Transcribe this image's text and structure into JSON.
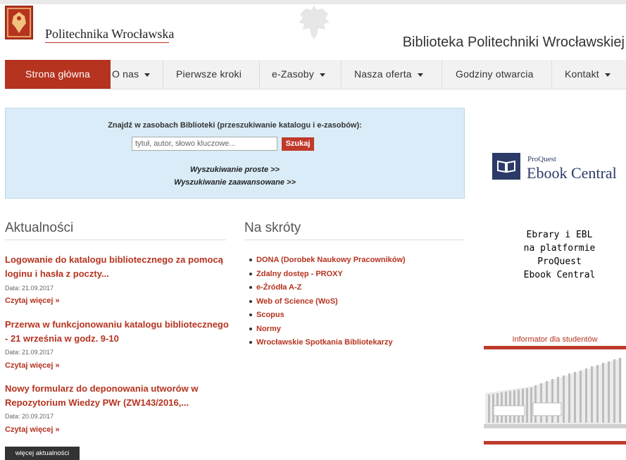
{
  "header": {
    "university": "Politechnika Wrocławska",
    "library": "Biblioteka Politechniki Wrocławskiej"
  },
  "nav": {
    "items": [
      {
        "label": "Strona główna",
        "active": true,
        "dropdown": false
      },
      {
        "label": "O nas",
        "dropdown": true
      },
      {
        "label": "Pierwsze kroki",
        "dropdown": false
      },
      {
        "label": "e-Zasoby",
        "dropdown": true
      },
      {
        "label": "Nasza oferta",
        "dropdown": true
      },
      {
        "label": "Godziny otwarcia",
        "dropdown": false
      },
      {
        "label": "Kontakt",
        "dropdown": true
      }
    ]
  },
  "search": {
    "label": "Znajdź w zasobach Biblioteki (przeszukiwanie katalogu i e-zasobów):",
    "placeholder": "tytuł, autor, słowo kluczowe...",
    "button": "Szukaj",
    "simple": "Wyszukiwanie proste >>",
    "advanced": "Wyszukiwanie zaawansowane >>"
  },
  "news": {
    "title": "Aktualności",
    "items": [
      {
        "title": "Logowanie do katalogu bibliotecznego za pomocą loginu i hasła z poczty...",
        "date": "Data: 21.09.2017",
        "more": "Czytaj więcej »"
      },
      {
        "title": "Przerwa w funkcjonowaniu katalogu bibliotecznego - 21 września w godz. 9-10",
        "date": "Data: 21.09.2017",
        "more": "Czytaj więcej »"
      },
      {
        "title": "Nowy formularz do deponowania utworów w Repozytorium Wiedzy PWr (ZW143/2016,...",
        "date": "Data: 20.09.2017",
        "more": "Czytaj więcej »"
      }
    ],
    "more_button": "więcej aktualności"
  },
  "shortcuts": {
    "title": "Na skróty",
    "items": [
      "DONA (Dorobek Naukowy Pracowników)",
      "Zdalny dostęp - PROXY",
      "e-Źródła A-Z",
      "Web of Science (WoS)",
      "Scopus",
      "Normy",
      "Wrocławskie Spotkania Bibliotekarzy"
    ]
  },
  "sidebar": {
    "proquest_small": "ProQuest",
    "proquest_big": "Ebook Central",
    "ebrary_lines": [
      "Ebrary i EBL",
      "na platformie",
      "ProQuest",
      "Ebook Central"
    ],
    "informator": "Informator dla studentów"
  },
  "colors": {
    "accent": "#b5331f",
    "search_bg": "#d9ecf7",
    "nav_bg": "#f2f2f2"
  }
}
